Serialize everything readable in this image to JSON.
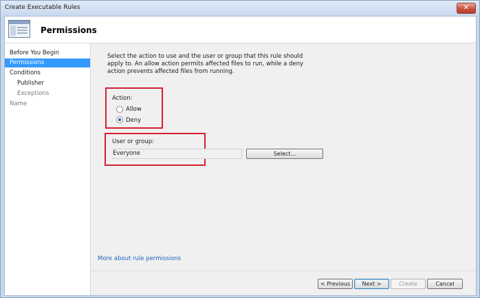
{
  "window": {
    "title": "Create Executable Rules",
    "close_label": "✕"
  },
  "header": {
    "title": "Permissions",
    "icon": "window-layout-icon"
  },
  "nav": {
    "items": [
      {
        "label": "Before You Begin"
      },
      {
        "label": "Permissions"
      },
      {
        "label": "Conditions"
      },
      {
        "label": "Publisher"
      },
      {
        "label": "Exceptions"
      },
      {
        "label": "Name"
      }
    ]
  },
  "main": {
    "description": "Select the action to use and the user or group that this rule should apply to. An allow action permits affected files to run, while a deny action prevents affected files from running.",
    "action": {
      "label": "Action:",
      "options": [
        {
          "label": "Allow",
          "selected": false
        },
        {
          "label": "Deny",
          "selected": true
        }
      ]
    },
    "user_group": {
      "label": "User or group:",
      "value": "Everyone",
      "select_label": "Select..."
    },
    "more_link": "More about rule permissions"
  },
  "footer": {
    "previous_label": "< Previous",
    "next_label": "Next >",
    "create_label": "Create",
    "cancel_label": "Cancel"
  },
  "colors": {
    "highlight": "#d32030",
    "selection": "#3399ff",
    "link": "#1f63b8"
  }
}
